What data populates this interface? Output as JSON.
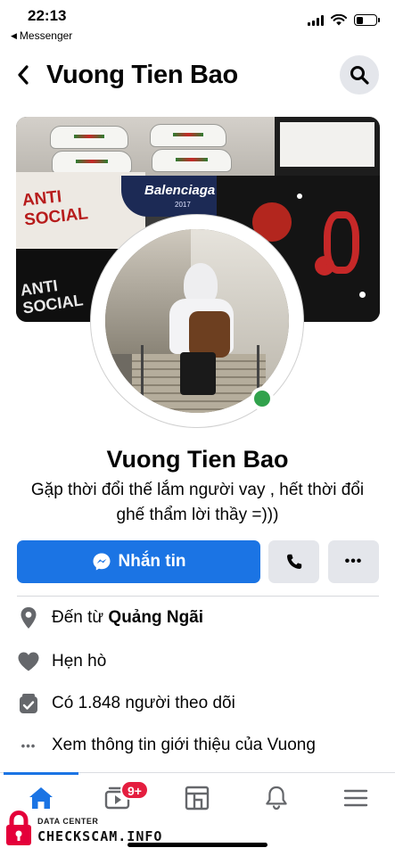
{
  "status_bar": {
    "time": "22:13",
    "back_app": "Messenger",
    "battery_level": 0.35
  },
  "header": {
    "title": "Vuong Tien Bao"
  },
  "cover": {
    "print_white": "ANTI\nSOCIAL",
    "print_navy": "Balenciaga",
    "print_navy_year": "2017",
    "print_black": "ANTI\nSOCIAL"
  },
  "profile": {
    "name": "Vuong Tien Bao",
    "bio": "Gặp thời đổi thế lắm người vay , hết thời đổi ghế thẩm lời thầy =)))",
    "online": true,
    "online_color": "#31a24c"
  },
  "actions": {
    "message_label": "Nhắn tin",
    "accent": "#1b74e4"
  },
  "info": {
    "from_prefix": "Đến từ",
    "from_place": "Quảng Ngãi",
    "dating": "Hẹn hò",
    "followers": "Có 1.848 người theo dõi",
    "about": "Xem thông tin giới thiệu của Vuong"
  },
  "bottom_nav": {
    "items": [
      "home-icon",
      "watch-icon",
      "pages-icon",
      "notifications-icon",
      "menu-icon"
    ],
    "watch_badge": "9+"
  },
  "watermark": {
    "small": "DATA CENTER",
    "big": "CHECKSCAM.INFO"
  }
}
